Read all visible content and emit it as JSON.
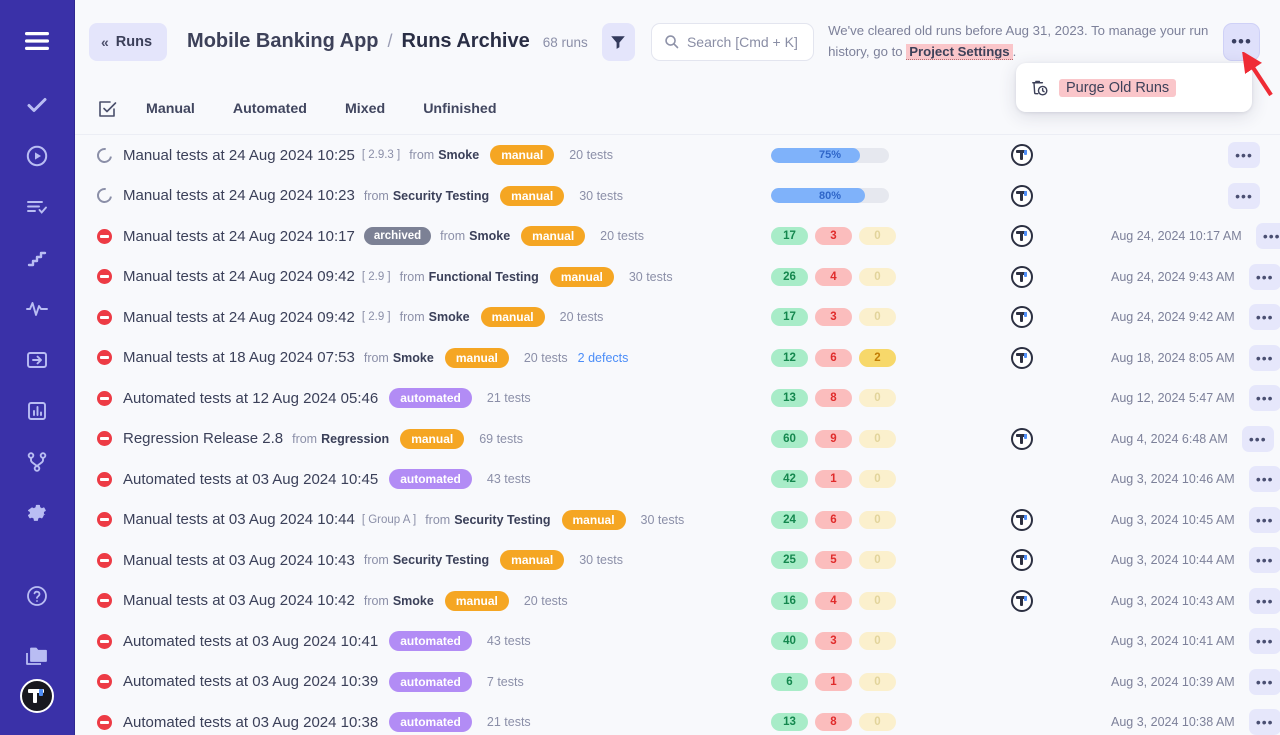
{
  "sidebar": {
    "items": [
      {
        "name": "menu-icon",
        "icon": "hamburger"
      },
      {
        "name": "tests-icon",
        "icon": "check"
      },
      {
        "name": "runs-icon",
        "icon": "play-circle"
      },
      {
        "name": "plans-icon",
        "icon": "list-check"
      },
      {
        "name": "steps-icon",
        "icon": "stairs"
      },
      {
        "name": "activity-icon",
        "icon": "pulse"
      },
      {
        "name": "import-icon",
        "icon": "arrow-into-box"
      },
      {
        "name": "reports-icon",
        "icon": "bar-chart"
      },
      {
        "name": "integrations-icon",
        "icon": "branch"
      },
      {
        "name": "settings-icon",
        "icon": "gear"
      }
    ],
    "bottom": [
      {
        "name": "help-icon",
        "icon": "question-circle"
      },
      {
        "name": "projects-icon",
        "icon": "folders"
      }
    ],
    "avatar_label": "T"
  },
  "header": {
    "back_label": "Runs",
    "back_chevron": "«",
    "app_name": "Mobile Banking App",
    "separator": "/",
    "current_page": "Runs Archive",
    "runs_count": "68 runs",
    "search_placeholder": "Search [Cmd + K]",
    "notice_prefix": "We've cleared old runs before Aug 31, 2023. To manage your run history, go to ",
    "notice_link": "Project Settings",
    "notice_suffix": ".",
    "more_label": "•••"
  },
  "dropdown": {
    "items": [
      {
        "label": "Purge Old Runs",
        "icon": "trash-clock-icon"
      }
    ]
  },
  "tabs": {
    "items": [
      {
        "label": "Manual"
      },
      {
        "label": "Automated"
      },
      {
        "label": "Mixed"
      },
      {
        "label": "Unfinished"
      }
    ]
  },
  "colors": {
    "sidebar_bg": "#3a31a8",
    "accent": "#5b54d6",
    "manual_tag": "#f5a623",
    "automated_tag": "#b28cf5",
    "pass": "#14874e",
    "fail": "#e02b2b",
    "blocked": "#c27d05",
    "link": "#4b8df8",
    "highlight": "#fac6ca"
  },
  "rows": [
    {
      "status": "running",
      "title": "Manual tests at 24 Aug 2024 10:25",
      "version": "[ 2.9.3 ]",
      "archived": null,
      "from_label": "from",
      "suite": "Smoke",
      "type": "manual",
      "tests": "20 tests",
      "defects": null,
      "progress": 75,
      "progress_label": "75%",
      "stats": null,
      "avatar": true,
      "date": ""
    },
    {
      "status": "running",
      "title": "Manual tests at 24 Aug 2024 10:23",
      "version": null,
      "archived": null,
      "from_label": "from",
      "suite": "Security Testing",
      "type": "manual",
      "tests": "30 tests",
      "defects": null,
      "progress": 80,
      "progress_label": "80%",
      "stats": null,
      "avatar": true,
      "date": ""
    },
    {
      "status": "stopped",
      "title": "Manual tests at 24 Aug 2024 10:17",
      "version": null,
      "archived": "archived",
      "from_label": "from",
      "suite": "Smoke",
      "type": "manual",
      "tests": "20 tests",
      "defects": null,
      "progress": null,
      "progress_label": null,
      "stats": {
        "pass": "17",
        "fail": "3",
        "blocked": "0"
      },
      "avatar": true,
      "date": "Aug 24, 2024 10:17 AM"
    },
    {
      "status": "stopped",
      "title": "Manual tests at 24 Aug 2024 09:42",
      "version": "[ 2.9 ]",
      "archived": null,
      "from_label": "from",
      "suite": "Functional Testing",
      "type": "manual",
      "tests": "30 tests",
      "defects": null,
      "progress": null,
      "progress_label": null,
      "stats": {
        "pass": "26",
        "fail": "4",
        "blocked": "0"
      },
      "avatar": true,
      "date": "Aug 24, 2024 9:43 AM"
    },
    {
      "status": "stopped",
      "title": "Manual tests at 24 Aug 2024 09:42",
      "version": "[ 2.9 ]",
      "archived": null,
      "from_label": "from",
      "suite": "Smoke",
      "type": "manual",
      "tests": "20 tests",
      "defects": null,
      "progress": null,
      "progress_label": null,
      "stats": {
        "pass": "17",
        "fail": "3",
        "blocked": "0"
      },
      "avatar": true,
      "date": "Aug 24, 2024 9:42 AM"
    },
    {
      "status": "stopped",
      "title": "Manual tests at 18 Aug 2024 07:53",
      "version": null,
      "archived": null,
      "from_label": "from",
      "suite": "Smoke",
      "type": "manual",
      "tests": "20 tests",
      "defects": "2 defects",
      "progress": null,
      "progress_label": null,
      "stats": {
        "pass": "12",
        "fail": "6",
        "blocked": "2"
      },
      "avatar": true,
      "date": "Aug 18, 2024 8:05 AM"
    },
    {
      "status": "stopped",
      "title": "Automated tests at 12 Aug 2024 05:46",
      "version": null,
      "archived": null,
      "from_label": null,
      "suite": null,
      "type": "automated",
      "tests": "21 tests",
      "defects": null,
      "progress": null,
      "progress_label": null,
      "stats": {
        "pass": "13",
        "fail": "8",
        "blocked": "0"
      },
      "avatar": false,
      "date": "Aug 12, 2024 5:47 AM"
    },
    {
      "status": "stopped",
      "title": "Regression Release 2.8",
      "version": null,
      "archived": null,
      "from_label": "from",
      "suite": "Regression",
      "type": "manual",
      "tests": "69 tests",
      "defects": null,
      "progress": null,
      "progress_label": null,
      "stats": {
        "pass": "60",
        "fail": "9",
        "blocked": "0"
      },
      "avatar": true,
      "date": "Aug 4, 2024 6:48 AM"
    },
    {
      "status": "stopped",
      "title": "Automated tests at 03 Aug 2024 10:45",
      "version": null,
      "archived": null,
      "from_label": null,
      "suite": null,
      "type": "automated",
      "tests": "43 tests",
      "defects": null,
      "progress": null,
      "progress_label": null,
      "stats": {
        "pass": "42",
        "fail": "1",
        "blocked": "0"
      },
      "avatar": false,
      "date": "Aug 3, 2024 10:46 AM"
    },
    {
      "status": "stopped",
      "title": "Manual tests at 03 Aug 2024 10:44",
      "version": "[ Group A ]",
      "archived": null,
      "from_label": "from",
      "suite": "Security Testing",
      "type": "manual",
      "tests": "30 tests",
      "defects": null,
      "progress": null,
      "progress_label": null,
      "stats": {
        "pass": "24",
        "fail": "6",
        "blocked": "0"
      },
      "avatar": true,
      "date": "Aug 3, 2024 10:45 AM"
    },
    {
      "status": "stopped",
      "title": "Manual tests at 03 Aug 2024 10:43",
      "version": null,
      "archived": null,
      "from_label": "from",
      "suite": "Security Testing",
      "type": "manual",
      "tests": "30 tests",
      "defects": null,
      "progress": null,
      "progress_label": null,
      "stats": {
        "pass": "25",
        "fail": "5",
        "blocked": "0"
      },
      "avatar": true,
      "date": "Aug 3, 2024 10:44 AM"
    },
    {
      "status": "stopped",
      "title": "Manual tests at 03 Aug 2024 10:42",
      "version": null,
      "archived": null,
      "from_label": "from",
      "suite": "Smoke",
      "type": "manual",
      "tests": "20 tests",
      "defects": null,
      "progress": null,
      "progress_label": null,
      "stats": {
        "pass": "16",
        "fail": "4",
        "blocked": "0"
      },
      "avatar": true,
      "date": "Aug 3, 2024 10:43 AM"
    },
    {
      "status": "stopped",
      "title": "Automated tests at 03 Aug 2024 10:41",
      "version": null,
      "archived": null,
      "from_label": null,
      "suite": null,
      "type": "automated",
      "tests": "43 tests",
      "defects": null,
      "progress": null,
      "progress_label": null,
      "stats": {
        "pass": "40",
        "fail": "3",
        "blocked": "0"
      },
      "avatar": false,
      "date": "Aug 3, 2024 10:41 AM"
    },
    {
      "status": "stopped",
      "title": "Automated tests at 03 Aug 2024 10:39",
      "version": null,
      "archived": null,
      "from_label": null,
      "suite": null,
      "type": "automated",
      "tests": "7 tests",
      "defects": null,
      "progress": null,
      "progress_label": null,
      "stats": {
        "pass": "6",
        "fail": "1",
        "blocked": "0"
      },
      "avatar": false,
      "date": "Aug 3, 2024 10:39 AM"
    },
    {
      "status": "stopped",
      "title": "Automated tests at 03 Aug 2024 10:38",
      "version": null,
      "archived": null,
      "from_label": null,
      "suite": null,
      "type": "automated",
      "tests": "21 tests",
      "defects": null,
      "progress": null,
      "progress_label": null,
      "stats": {
        "pass": "13",
        "fail": "8",
        "blocked": "0"
      },
      "avatar": false,
      "date": "Aug 3, 2024 10:38 AM"
    }
  ],
  "row_more_label": "•••"
}
